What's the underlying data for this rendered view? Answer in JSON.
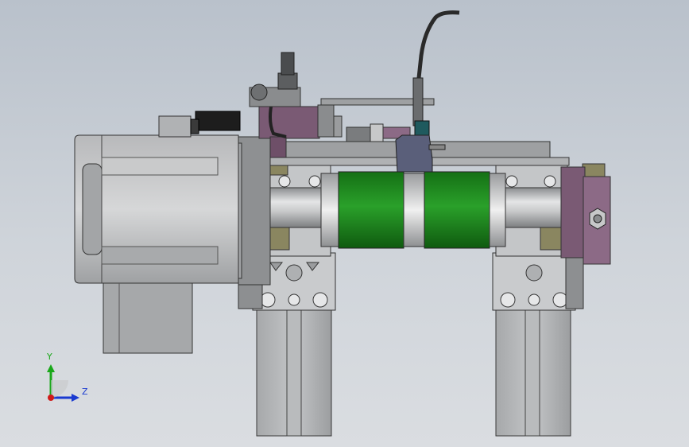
{
  "viewport": {
    "background_top": "#b9c1cb",
    "background_bottom": "#dadde1"
  },
  "model": {
    "components": [
      "servo-motor",
      "gearbox",
      "motor-flange",
      "roller-shaft",
      "green-roller",
      "aluminum-profile-left",
      "aluminum-profile-right",
      "top-plate",
      "cylinder-bracket",
      "proximity-sensor",
      "sensor-cable",
      "adjust-screw",
      "bearing-housing",
      "hex-bolt"
    ],
    "colors": {
      "roller_green": "#1f8a1f",
      "bracket_purple": "#7a5a74",
      "bearing_olive": "#8a8660",
      "metal_gray": "#b4b6b8",
      "sensor_teal": "#1f5a5e"
    }
  },
  "triad": {
    "y_label": "Y",
    "z_label": "Z",
    "y_color": "#1aa81a",
    "z_color": "#1a3ad0",
    "x_color": "#d01a1a"
  }
}
